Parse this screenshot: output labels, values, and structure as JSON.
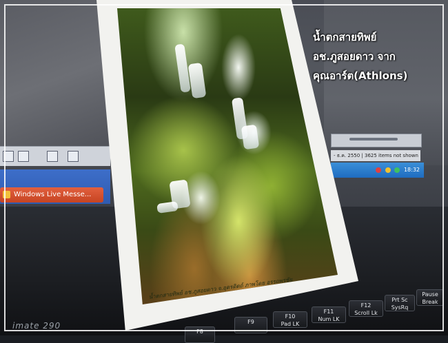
{
  "overlay": {
    "line1": "น้ำตกสายทิพย์",
    "line2": "อช.ภูสอยดาว จาก",
    "line3": "คุณอาร์ต(Athlons)"
  },
  "postcard": {
    "caption": "น้ำตกสายทิพย์ อช.ภูสอยดาว จ.อุตรดิตถ์ ภาพโดย อรรถพรชัย"
  },
  "screen": {
    "taskbar_button": "Windows Live Messe...",
    "status_text": "- ธ.ค. 2550 | 3625 items not shown",
    "clock": "18:32"
  },
  "laptop": {
    "brand": "imate 290",
    "keys": [
      {
        "top": "",
        "bottom": "F8"
      },
      {
        "top": "F9",
        "bottom": ""
      },
      {
        "top": "F10",
        "bottom": "Pad LK"
      },
      {
        "top": "F11",
        "bottom": "Num LK"
      },
      {
        "top": "F12",
        "bottom": "Scroll Lk"
      },
      {
        "top": "Prt Sc",
        "bottom": "SysRq"
      },
      {
        "top": "Pause",
        "bottom": "Break"
      }
    ]
  },
  "colors": {
    "overlay_text": "#ffffff",
    "taskbar": "#2f5bb0",
    "taskbar_button": "#d4502c"
  }
}
